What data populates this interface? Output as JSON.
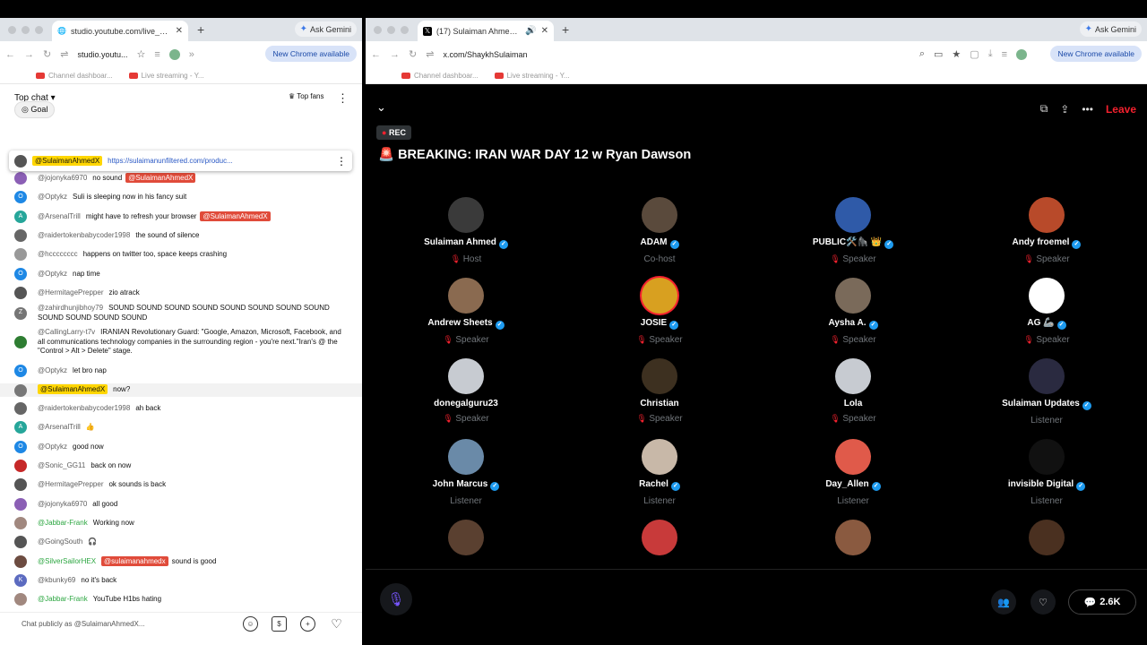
{
  "left_browser": {
    "tab_title": "studio.youtube.com/live_chat",
    "gemini_label": "Ask Gemini",
    "url": "studio.youtu...",
    "chrome_pill": "New Chrome available",
    "bookmarks": [
      "Channel dashboar...",
      "Live streaming - Y..."
    ]
  },
  "chat": {
    "title": "Top chat",
    "top_fans_label": "Top fans",
    "goal_label": "Goal",
    "pinned": {
      "author": "@SulaimanAhmedX",
      "link": "https://sulaimanunfiltered.com/produc..."
    },
    "messages": [
      {
        "author": "@jojonyka6970",
        "text": "no sound",
        "mention": "@SulaimanAhmedX",
        "color": "#8b5fb5",
        "initial": ""
      },
      {
        "author": "@Optykz",
        "text": "Suli is sleeping now in his fancy suit",
        "color": "#1e88e5",
        "initial": "O"
      },
      {
        "author": "@ArsenalTrill",
        "text": "might have to refresh your browser",
        "mention": "@SulaimanAhmedX",
        "color": "#26a69a",
        "initial": "A"
      },
      {
        "author": "@raidertokenbabycoder1998",
        "text": "the sound of silence",
        "color": "#666",
        "initial": ""
      },
      {
        "author": "@hcccccccc",
        "text": "happens on twitter too, space keeps crashing",
        "color": "#999",
        "initial": ""
      },
      {
        "author": "@Optykz",
        "text": "nap time",
        "color": "#1e88e5",
        "initial": "O"
      },
      {
        "author": "@HermitagePrepper",
        "text": "zio atrack",
        "color": "#555",
        "initial": ""
      },
      {
        "author": "@zahirdhunjibhoy79",
        "text": "SOUND SOUND SOUND SOUND SOUND SOUND SOUND SOUND SOUND SOUND SOUND SOUND",
        "color": "#757575",
        "initial": "Z"
      },
      {
        "author": "@CallingLarry-t7v",
        "text": "IRANIAN Revolutionary Guard: \"Google, Amazon, Microsoft, Facebook, and all communications technology companies in the surrounding region - you're next.\"Iran's @ the \"Control > Alt > Delete\" stage.",
        "color": "#2e7d32",
        "initial": ""
      },
      {
        "author": "@Optykz",
        "text": "let bro nap",
        "color": "#1e88e5",
        "initial": "O"
      },
      {
        "author": "",
        "text": "now?",
        "owner": "@SulaimanAhmedX",
        "color": "#777",
        "initial": ""
      },
      {
        "author": "@raidertokenbabycoder1998",
        "text": "ah back",
        "color": "#666",
        "initial": ""
      },
      {
        "author": "@ArsenalTrill",
        "text": "👍",
        "color": "#26a69a",
        "initial": "A"
      },
      {
        "author": "@Optykz",
        "text": "good now",
        "color": "#1e88e5",
        "initial": "O"
      },
      {
        "author": "@Sonic_GG11",
        "text": "back on now",
        "color": "#c62828",
        "initial": ""
      },
      {
        "author": "@HermitagePrepper",
        "text": "ok sounds is back",
        "color": "#555",
        "initial": ""
      },
      {
        "author": "@jojonyka6970",
        "text": "all good",
        "color": "#8b5fb5",
        "initial": ""
      },
      {
        "author": "@Jabbar-Frank",
        "text": "Working now",
        "color": "#a1887f",
        "initial": "",
        "member": true
      },
      {
        "author": "@GoingSouth",
        "text": "🎧",
        "color": "#555",
        "initial": ""
      },
      {
        "author": "@SilverSailorHEX",
        "text": "sound is good",
        "mention": "@sulaimanahmedx",
        "color": "#6d4c41",
        "initial": "",
        "member": true
      },
      {
        "author": "@kbunky69",
        "text": "no it's back",
        "color": "#5c6bc0",
        "initial": "K"
      },
      {
        "author": "@Jabbar-Frank",
        "text": "YouTube H1bs hating",
        "color": "#a1887f",
        "initial": "",
        "member": true
      }
    ],
    "input_placeholder": "Chat publicly as @SulaimanAhmedX..."
  },
  "right_browser": {
    "tab_title": "(17) Sulaiman Ahmed (@S",
    "gemini_label": "Ask Gemini",
    "url": "x.com/ShaykhSulaiman",
    "chrome_pill": "New Chrome available",
    "bookmarks": [
      "Channel dashboar...",
      "Live streaming - Y..."
    ]
  },
  "space": {
    "rec_label": "REC",
    "title": "🚨 BREAKING: IRAN WAR DAY 12 w Ryan Dawson",
    "leave_label": "Leave",
    "participants": [
      {
        "name": "Sulaiman Ahmed",
        "role": "Host",
        "verified": true,
        "color": "#3a3a3a"
      },
      {
        "name": "ADAM",
        "role": "Co-host",
        "verified": true,
        "color": "#5a4a3c"
      },
      {
        "name": "PUBLIC🛠️🦍 👑",
        "role": "Speaker",
        "verified": true,
        "color": "#2f5aa8"
      },
      {
        "name": "Andy froemel",
        "role": "Speaker",
        "verified": true,
        "color": "#b84a2a"
      },
      {
        "name": "Andrew Sheets",
        "role": "Speaker",
        "verified": true,
        "color": "#8a6a50"
      },
      {
        "name": "JOSIE",
        "role": "Speaker",
        "verified": true,
        "color": "#d8a020"
      },
      {
        "name": "Aysha A.",
        "role": "Speaker",
        "verified": true,
        "color": "#7a6a5a"
      },
      {
        "name": "AG 🦾",
        "role": "Speaker",
        "verified": true,
        "color": "#ffffff"
      },
      {
        "name": "donegalguru23",
        "role": "Speaker",
        "verified": false,
        "color": "#c7cbd1"
      },
      {
        "name": "Christian",
        "role": "Speaker",
        "verified": false,
        "color": "#3d3020"
      },
      {
        "name": "Lola",
        "role": "Speaker",
        "verified": false,
        "color": "#c7cbd1"
      },
      {
        "name": "Sulaiman Updates",
        "role": "Listener",
        "verified": true,
        "color": "#2a2a40"
      },
      {
        "name": "John Marcus",
        "role": "Listener",
        "verified": true,
        "color": "#6a8aa8"
      },
      {
        "name": "Rachel",
        "role": "Listener",
        "verified": true,
        "color": "#c8b8a8"
      },
      {
        "name": "Day_Allen",
        "role": "Listener",
        "verified": true,
        "color": "#e05a4a"
      },
      {
        "name": "invisible Digital",
        "role": "Listener",
        "verified": true,
        "color": "#111111"
      },
      {
        "name": "",
        "role": "",
        "verified": false,
        "color": "#5a4030"
      },
      {
        "name": "",
        "role": "",
        "verified": false,
        "color": "#c83a3a"
      },
      {
        "name": "",
        "role": "",
        "verified": false,
        "color": "#8a5a40"
      },
      {
        "name": "",
        "role": "",
        "verified": false,
        "color": "#4a3020"
      }
    ],
    "reply_count": "2.6K"
  }
}
